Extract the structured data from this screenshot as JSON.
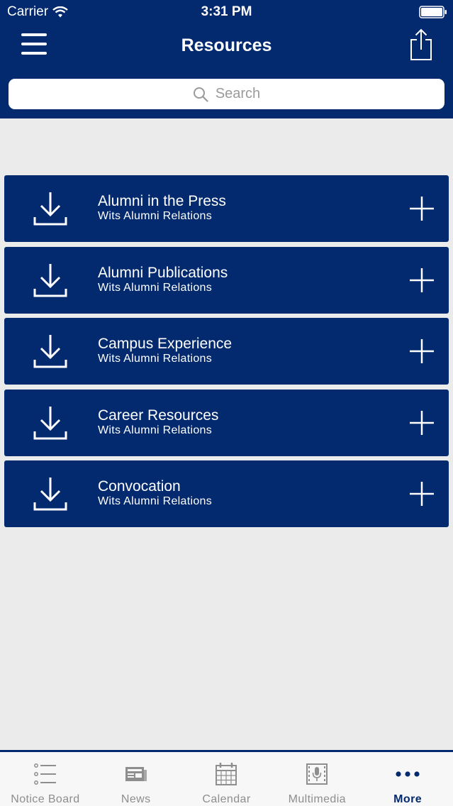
{
  "status_bar": {
    "carrier": "Carrier",
    "time": "3:31 PM"
  },
  "header": {
    "title": "Resources",
    "menu_icon": "hamburger-menu-icon",
    "share_icon": "share-icon"
  },
  "search": {
    "placeholder": "Search"
  },
  "colors": {
    "brand": "#032a6f",
    "background": "#ebebeb",
    "tab_inactive": "#8e8e8e"
  },
  "resources": [
    {
      "title": "Alumni in the Press",
      "subtitle": "Wits Alumni Relations"
    },
    {
      "title": "Alumni Publications",
      "subtitle": "Wits Alumni Relations"
    },
    {
      "title": "Campus Experience",
      "subtitle": "Wits Alumni Relations"
    },
    {
      "title": "Career Resources",
      "subtitle": "Wits Alumni Relations"
    },
    {
      "title": "Convocation",
      "subtitle": "Wits Alumni Relations"
    }
  ],
  "tabs": [
    {
      "label": "Notice Board",
      "icon": "list-icon"
    },
    {
      "label": "News",
      "icon": "newspaper-icon"
    },
    {
      "label": "Calendar",
      "icon": "calendar-icon"
    },
    {
      "label": "Multimedia",
      "icon": "microphone-icon"
    },
    {
      "label": "More",
      "icon": "more-icon",
      "active": true
    }
  ]
}
